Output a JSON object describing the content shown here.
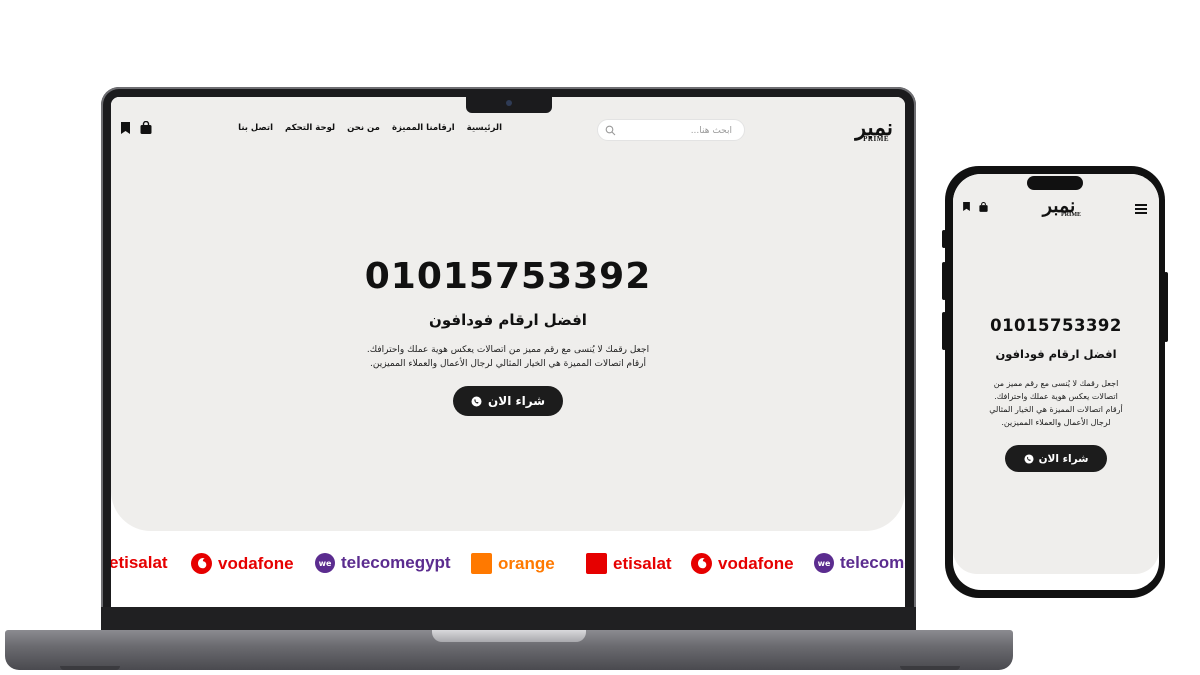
{
  "site": {
    "logo_ar": "نمبر",
    "logo_en": "PRIME",
    "search": {
      "placeholder": "ابحث هنا..."
    },
    "menu": [
      {
        "label": "الرئيسية"
      },
      {
        "label": "ارقامنا المميزة"
      },
      {
        "label": "من نحن"
      },
      {
        "label": "لوحة التحكم"
      },
      {
        "label": "اتصل بنا"
      }
    ],
    "hero": {
      "number": "01015753392",
      "title": "افضل ارقام فودافون",
      "desc_line1": "اجعل رقمك لا يُنسى مع رقم مميز من اتصالات يعكس هوية عملك واحترافك.",
      "desc_line2": "أرقام اتصالات المميزة هي الخيار المثالي لرجال الأعمال والعملاء المميزين.",
      "button": "شراء الان"
    },
    "brands": [
      {
        "name": "etisalat",
        "color": "#e60000"
      },
      {
        "name": "vodafone",
        "color": "#e60000"
      },
      {
        "name": "telecomegypt",
        "color": "#5b2c8f"
      },
      {
        "name": "orange",
        "color": "#ff7900"
      },
      {
        "name": "etisalat",
        "color": "#e60000"
      },
      {
        "name": "vodafone",
        "color": "#e60000"
      },
      {
        "name": "telecomegypt",
        "color": "#5b2c8f"
      }
    ]
  },
  "mobile": {
    "desc": "اجعل رقمك لا يُنسى مع رقم مميز من اتصالات يعكس هوية عملك واحترافك. أرقام اتصالات المميزة هي الخيار المثالي لرجال الأعمال والعملاء المميزين."
  }
}
